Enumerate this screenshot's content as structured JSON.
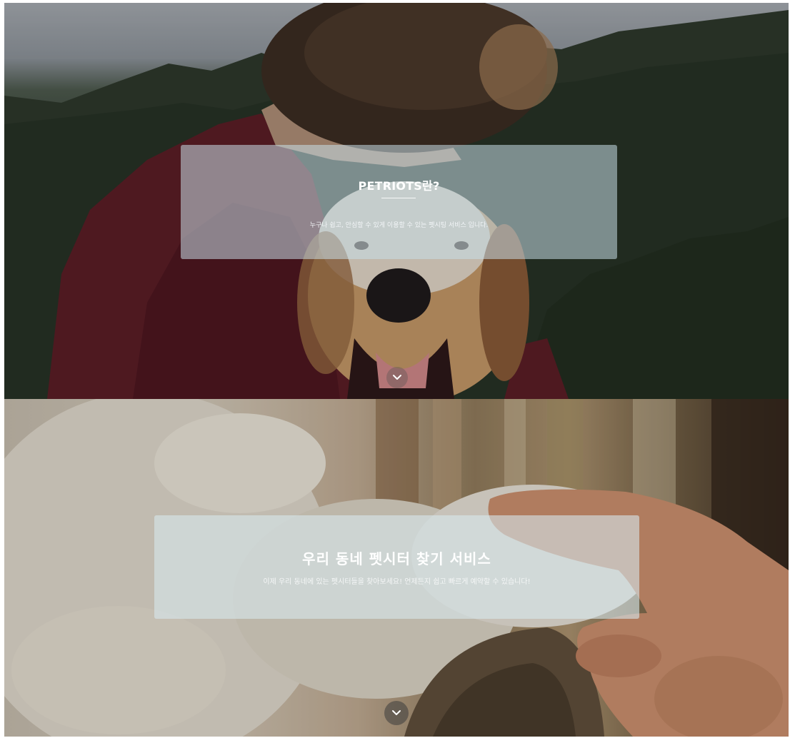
{
  "section_1": {
    "title": "PETRIOTS란?",
    "description": "누구나 쉽고, 안심할 수 있게 이용할 수 있는 펫시팅 서비스 입니다.",
    "scroll_icon": "chevron-down-icon"
  },
  "section_2": {
    "title": "우리 동네 펫시터 찾기 서비스",
    "description": "이제 우리 동네에 있는 펫시터들을 찾아보세요! 언제든지 쉽고 빠르게 예약할 수 있습니다!",
    "scroll_icon": "chevron-down-icon"
  },
  "colors": {
    "box_1_background": "#c8dee8",
    "box_2_background": "#d7e8ec",
    "text": "#ffffff",
    "scroll_button": "#3c3c3c"
  }
}
